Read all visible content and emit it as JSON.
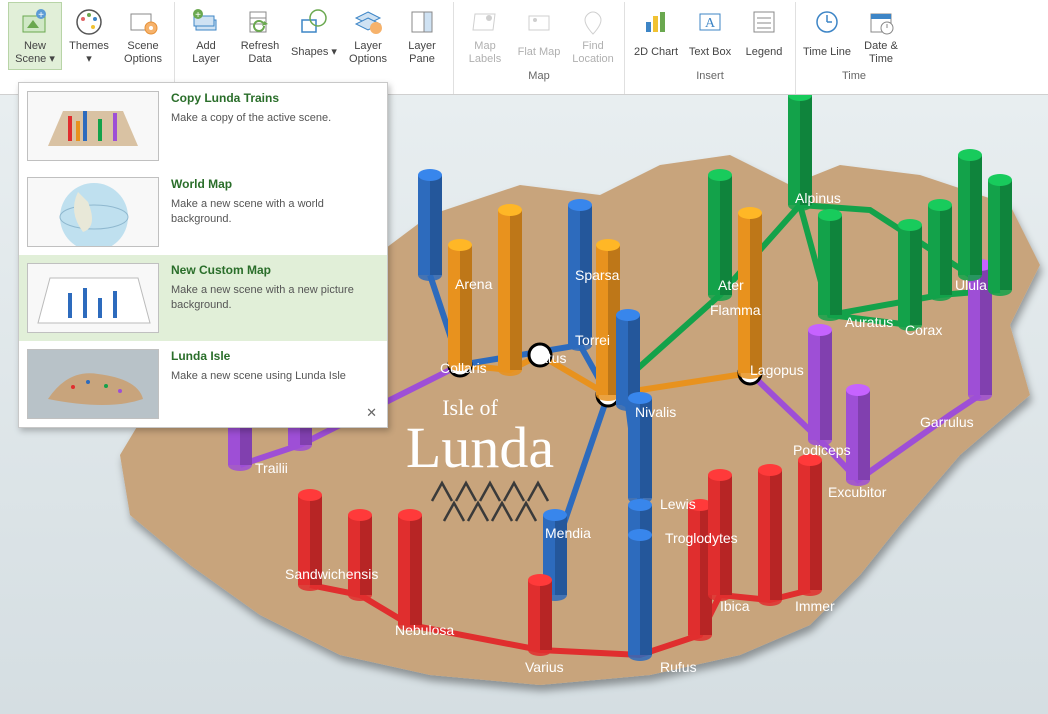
{
  "ribbon": {
    "groups": [
      {
        "label": "",
        "buttons": [
          {
            "label": "New Scene ▾",
            "name": "new-scene-button",
            "icon": "new-scene-icon",
            "active": true
          },
          {
            "label": "Themes ▾",
            "name": "themes-button",
            "icon": "themes-icon"
          },
          {
            "label": "Scene Options",
            "name": "scene-options-button",
            "icon": "scene-options-icon"
          }
        ]
      },
      {
        "label": "",
        "buttons": [
          {
            "label": "Add Layer",
            "name": "add-layer-button",
            "icon": "add-layer-icon"
          },
          {
            "label": "Refresh Data",
            "name": "refresh-data-button",
            "icon": "refresh-data-icon"
          },
          {
            "label": "Shapes ▾",
            "name": "shapes-button",
            "icon": "shapes-icon"
          },
          {
            "label": "Layer Options",
            "name": "layer-options-button",
            "icon": "layer-options-icon"
          },
          {
            "label": "Layer Pane",
            "name": "layer-pane-button",
            "icon": "layer-pane-icon"
          }
        ]
      },
      {
        "label": "Map",
        "buttons": [
          {
            "label": "Map Labels",
            "name": "map-labels-button",
            "icon": "map-labels-icon",
            "disabled": true
          },
          {
            "label": "Flat Map",
            "name": "flat-map-button",
            "icon": "flat-map-icon",
            "disabled": true
          },
          {
            "label": "Find Location",
            "name": "find-location-button",
            "icon": "find-location-icon",
            "disabled": true
          }
        ]
      },
      {
        "label": "Insert",
        "buttons": [
          {
            "label": "2D Chart",
            "name": "2d-chart-button",
            "icon": "chart-icon"
          },
          {
            "label": "Text Box",
            "name": "text-box-button",
            "icon": "textbox-icon"
          },
          {
            "label": "Legend",
            "name": "legend-button",
            "icon": "legend-icon"
          }
        ]
      },
      {
        "label": "Time",
        "buttons": [
          {
            "label": "Time Line",
            "name": "timeline-button",
            "icon": "timeline-icon"
          },
          {
            "label": "Date & Time",
            "name": "date-time-button",
            "icon": "datetime-icon"
          }
        ]
      }
    ]
  },
  "dropdown": {
    "items": [
      {
        "title": "Copy Lunda Trains",
        "desc": "Make a copy of the active scene.",
        "thumb": "lunda-mini"
      },
      {
        "title": "World Map",
        "desc": "Make a new scene with a world background.",
        "thumb": "globe"
      },
      {
        "title": "New Custom Map",
        "desc": "Make a new scene with a new picture background.",
        "thumb": "custom",
        "selected": true
      },
      {
        "title": "Lunda Isle",
        "desc": "Make a new scene using Lunda Isle",
        "thumb": "lunda-blur",
        "closable": true
      }
    ]
  },
  "map": {
    "title_sub": "Isle of",
    "title": "Lunda",
    "towns": {
      "trailii": "Trailii",
      "collaris": "Collaris",
      "arena": "Arena",
      "atus": "atus",
      "sparsa": "Sparsa",
      "torrei": "Torrei",
      "nivalis": "Nivalis",
      "lewis": "Lewis",
      "mendia": "Mendia",
      "troglodytes": "Troglodytes",
      "rufus": "Rufus",
      "varius": "Varius",
      "nebulosa": "Nebulosa",
      "sandwichensis": "Sandwichensis",
      "ibica": "Ibica",
      "immer": "Immer",
      "lagopus": "Lagopus",
      "podiceps": "Podiceps",
      "excubitor": "Excubitor",
      "garrulus": "Garrulus",
      "ater": "Ater",
      "flamma": "Flamma",
      "auratus": "Auratus",
      "corax": "Corax",
      "alpinus": "Alpinus",
      "ulula": "Ulula"
    },
    "colors": {
      "island": "#c8a47c",
      "blue": "#2d6bbd",
      "orange": "#e8921e",
      "green": "#13a24a",
      "purple": "#9e4fd6",
      "red": "#e02e2e"
    }
  }
}
